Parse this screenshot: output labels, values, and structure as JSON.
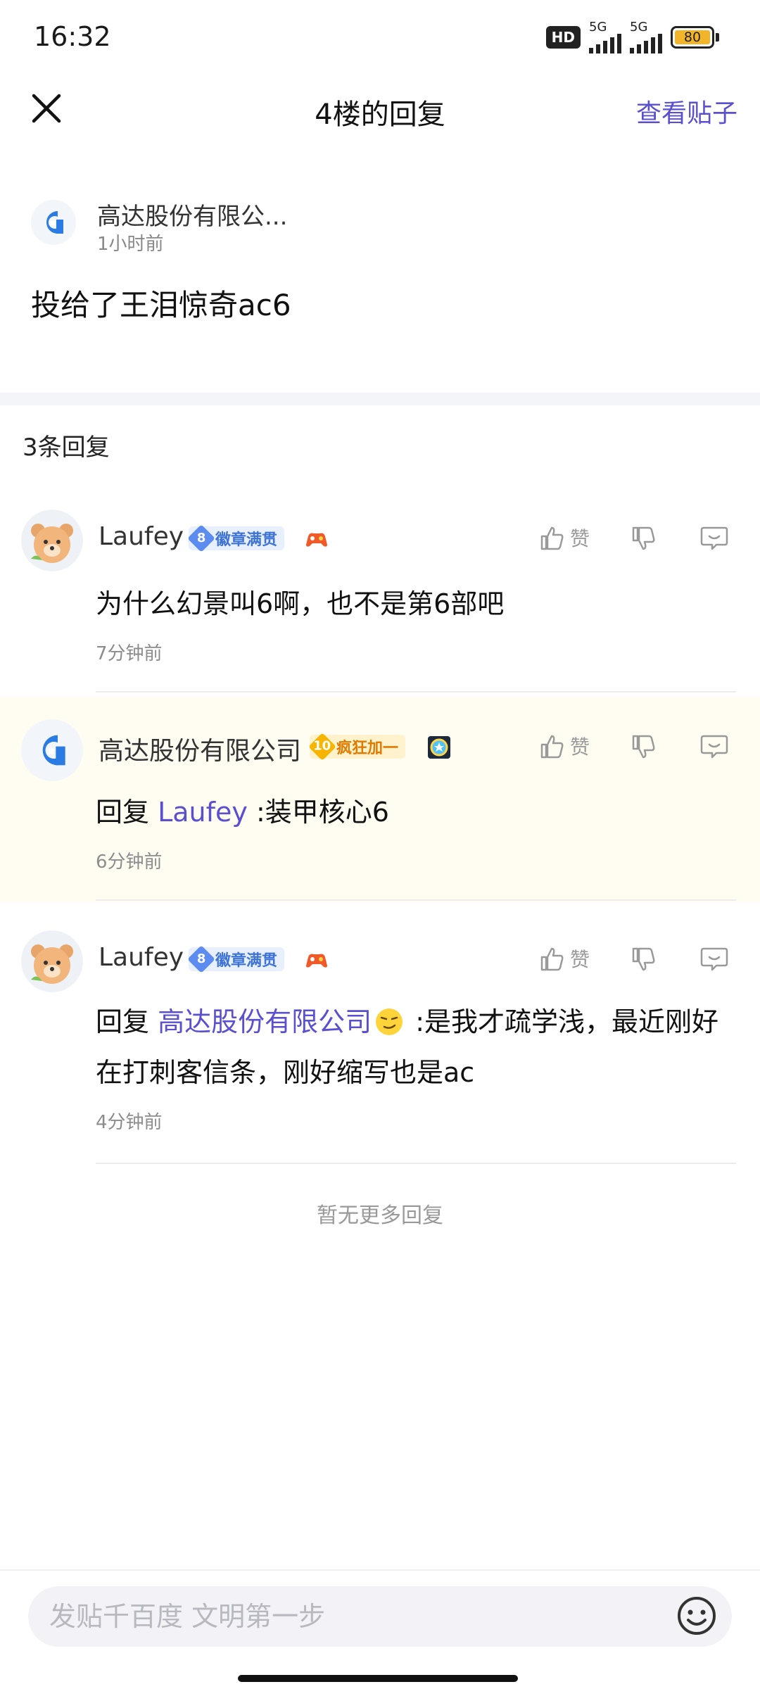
{
  "status_bar": {
    "time": "16:32",
    "hd_label": "HD",
    "net1": "5G",
    "net2": "5G",
    "battery": "80"
  },
  "header": {
    "title": "4楼的回复",
    "view_post_label": "查看贴子"
  },
  "post": {
    "author": "高达股份有限公...",
    "time": "1小时前",
    "text": "投给了王泪惊奇ac6"
  },
  "reply_count": "3条回复",
  "actions": {
    "like_label": "赞"
  },
  "replies": [
    {
      "name": "Laufey",
      "badge_level": "8",
      "badge_text": "徽章满贯",
      "text": "为什么幻景叫6啊，也不是第6部吧",
      "time": "7分钟前"
    },
    {
      "name": "高达股份有限公司",
      "badge_level": "10",
      "badge_text": "疯狂加一",
      "reply_prefix": "回复 ",
      "mention": "Laufey",
      "text": " :装甲核心6",
      "time": "6分钟前"
    },
    {
      "name": "Laufey",
      "badge_level": "8",
      "badge_text": "徽章满贯",
      "reply_prefix": "回复 ",
      "mention": "高达股份有限公司",
      "text": " :是我才疏学浅，最近刚好在打刺客信条，刚好缩写也是ac",
      "time": "4分钟前"
    }
  ],
  "no_more": "暂无更多回复",
  "input": {
    "placeholder": "发贴千百度 文明第一步"
  },
  "colors": {
    "accent": "#5a4fcf",
    "highlight_bg": "#fffdf2"
  }
}
